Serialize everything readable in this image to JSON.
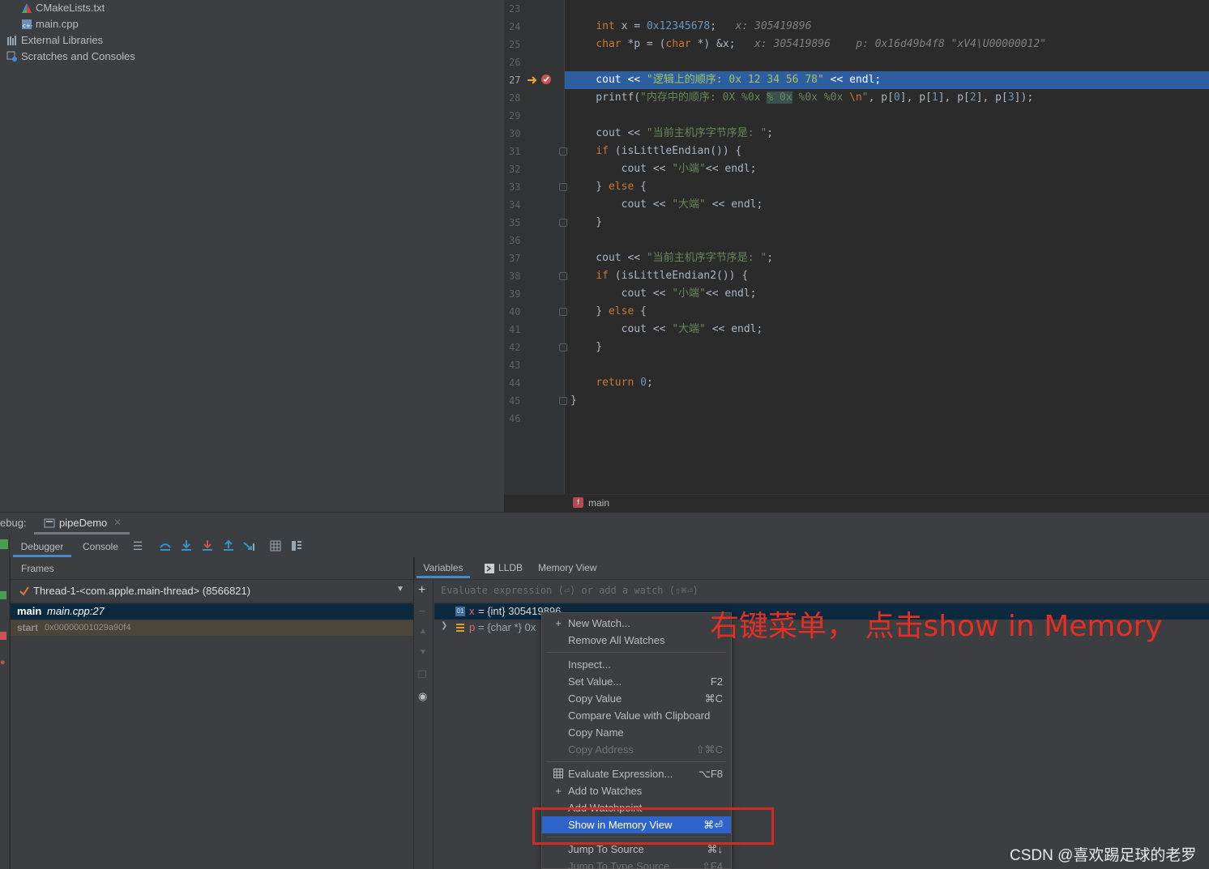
{
  "project_tree": {
    "items": [
      {
        "label": "CMakeLists.txt",
        "icon": "cmake-file-icon"
      },
      {
        "label": "main.cpp",
        "icon": "cpp-file-icon"
      },
      {
        "label": "External Libraries",
        "icon": "libraries-icon"
      },
      {
        "label": "Scratches and Consoles",
        "icon": "scratches-icon"
      }
    ]
  },
  "editor": {
    "line_numbers": [
      "23",
      "24",
      "25",
      "26",
      "27",
      "28",
      "29",
      "30",
      "31",
      "32",
      "33",
      "34",
      "35",
      "36",
      "37",
      "38",
      "39",
      "40",
      "41",
      "42",
      "43",
      "44",
      "45",
      "46"
    ],
    "current_line": "27",
    "breadcrumb": "main",
    "breadcrumb_icon": "f",
    "inline_values": {
      "line24": "x: 305419896",
      "line25_x": "x: 305419896",
      "line25_p": "p: 0x16d49b4f8 \"xV4\\U00000012\""
    }
  },
  "debug": {
    "label": "ebug:",
    "session_tab": "pipeDemo",
    "tabs": [
      "Debugger",
      "Console"
    ],
    "frames_title": "Frames",
    "thread": "Thread-1-<com.apple.main-thread> (8566821)",
    "frames": [
      {
        "name": "main",
        "loc": "main.cpp:27"
      },
      {
        "name": "start",
        "loc": "0x00000001029a90f4"
      }
    ],
    "var_tabs": [
      "Variables",
      "LLDB",
      "Memory View"
    ],
    "eval_placeholder": "Evaluate expression (⏎) or add a watch (⇧⌘⏎)",
    "variables": [
      {
        "name": "x",
        "value": "= {int} 305419896"
      },
      {
        "name": "p",
        "value": "= {char *} 0x"
      }
    ]
  },
  "context_menu": {
    "items": [
      {
        "label": "New Watch...",
        "shortcut": "",
        "icon": "+"
      },
      {
        "label": "Remove All Watches",
        "shortcut": ""
      },
      {
        "label": "Inspect...",
        "shortcut": ""
      },
      {
        "label": "Set Value...",
        "shortcut": "F2"
      },
      {
        "label": "Copy Value",
        "shortcut": "⌘C"
      },
      {
        "label": "Compare Value with Clipboard",
        "shortcut": ""
      },
      {
        "label": "Copy Name",
        "shortcut": ""
      },
      {
        "label": "Copy Address",
        "shortcut": "⇧⌘C"
      },
      {
        "label": "Evaluate Expression...",
        "shortcut": "⌥F8"
      },
      {
        "label": "Add to Watches",
        "shortcut": ""
      },
      {
        "label": "Add Watchpoint",
        "shortcut": ""
      },
      {
        "label": "Show in Memory View",
        "shortcut": "⌘⏎"
      },
      {
        "label": "Jump To Source",
        "shortcut": "⌘↓"
      },
      {
        "label": "Jump To Type Source",
        "shortcut": "⇧F4"
      }
    ]
  },
  "annotation": "右键菜单， 点击show in Memory",
  "watermark": "CSDN @喜欢踢足球的老罗",
  "colors": {
    "keyword": "#cc7832",
    "number": "#6897bb",
    "string": "#6a8759",
    "selection": "#2f65ca",
    "annotation": "#e52f25"
  }
}
